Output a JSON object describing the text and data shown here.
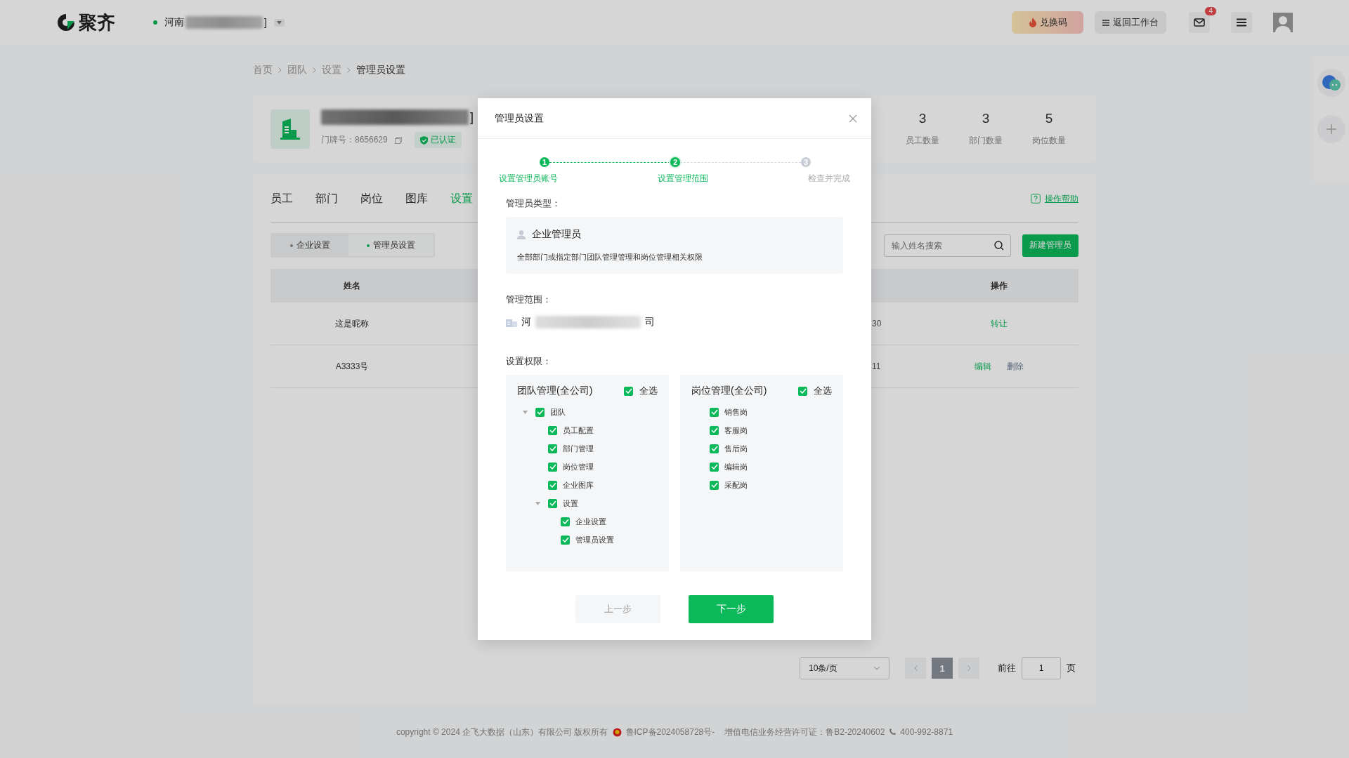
{
  "topbar": {
    "logo": "聚齐",
    "org": {
      "name": "河南",
      "end": "]"
    },
    "redeem": "兑换码",
    "workbench": "返回工作台",
    "mail_badge": "4"
  },
  "breadcrumb": [
    {
      "label": "首页",
      "selected": false
    },
    {
      "label": "团队",
      "selected": false
    },
    {
      "label": "设置",
      "selected": false
    },
    {
      "label": "管理员设置",
      "selected": true
    }
  ],
  "company": {
    "name_end": "]",
    "door_label": "门牌号：",
    "door_no": "8656629",
    "verified": "已认证",
    "stats": [
      {
        "value": "3",
        "label": "员工数量"
      },
      {
        "value": "3",
        "label": "部门数量"
      },
      {
        "value": "5",
        "label": "岗位数量"
      }
    ]
  },
  "tabs": [
    {
      "label": "员工",
      "selected": false
    },
    {
      "label": "部门",
      "selected": false
    },
    {
      "label": "岗位",
      "selected": false
    },
    {
      "label": "图库",
      "selected": false
    },
    {
      "label": "设置",
      "selected": true
    }
  ],
  "help": "操作帮助",
  "subtabs": [
    {
      "label": "企业设置",
      "selected": false
    },
    {
      "label": "管理员设置",
      "selected": true
    }
  ],
  "search": {
    "placeholder": "输入姓名搜索"
  },
  "new_button": "新建管理员",
  "table": {
    "columns": [
      "姓名",
      "操作"
    ],
    "rows": [
      {
        "name": "这是昵称",
        "partial": "30",
        "actions": [
          {
            "label": "转让",
            "kind": "primary"
          }
        ]
      },
      {
        "name": "A3333号",
        "partial": "11",
        "actions": [
          {
            "label": "编辑",
            "kind": "primary"
          },
          {
            "label": "删除",
            "kind": "muted"
          }
        ]
      }
    ]
  },
  "pagination": {
    "page_size": "10条/页",
    "pages": [
      {
        "label": "1",
        "selected": true
      }
    ],
    "goto_label": "前往",
    "goto_value": "1",
    "page_unit": "页"
  },
  "footer": {
    "copyright": "copyright © 2024 企飞大数据（山东）有限公司 版权所有",
    "icp": "鲁ICP备2024058728号-",
    "license": "增值电信业务经营许可证：鲁B2-20240602",
    "phone": "400-992-8871"
  },
  "dialog": {
    "title": "管理员设置",
    "steps": [
      {
        "number": "1",
        "label": "设置管理员账号",
        "done": true,
        "selected": false
      },
      {
        "number": "2",
        "label": "设置管理范围",
        "done": false,
        "selected": true
      },
      {
        "number": "3",
        "label": "检查并完成",
        "done": false,
        "selected": false
      }
    ],
    "type_label": "管理员类型：",
    "type": {
      "name": "企业管理员",
      "description": "全部部门或指定部门团队管理管理和岗位管理相关权限"
    },
    "scope_label": "管理范围：",
    "scope": {
      "start": "河",
      "end": "司"
    },
    "perm_label": "设置权限：",
    "panels": [
      {
        "title": "团队管理(全公司)",
        "select_all": {
          "label": "全选",
          "checked": true
        },
        "items": [
          {
            "label": "团队",
            "checked": true,
            "expanded": true,
            "children": [
              {
                "label": "员工配置",
                "checked": true
              },
              {
                "label": "部门管理",
                "checked": true
              },
              {
                "label": "岗位管理",
                "checked": true
              },
              {
                "label": "企业图库",
                "checked": true
              },
              {
                "label": "设置",
                "checked": true,
                "expanded": true,
                "children": [
                  {
                    "label": "企业设置",
                    "checked": true
                  },
                  {
                    "label": "管理员设置",
                    "checked": true
                  }
                ]
              }
            ]
          }
        ]
      },
      {
        "title": "岗位管理(全公司)",
        "select_all": {
          "label": "全选",
          "checked": true
        },
        "items": [
          {
            "label": "销售岗",
            "checked": true
          },
          {
            "label": "客服岗",
            "checked": true
          },
          {
            "label": "售后岗",
            "checked": true
          },
          {
            "label": "编辑岗",
            "checked": true
          },
          {
            "label": "采配岗",
            "checked": true
          }
        ]
      }
    ],
    "prev": "上一步",
    "next": "下一步"
  }
}
